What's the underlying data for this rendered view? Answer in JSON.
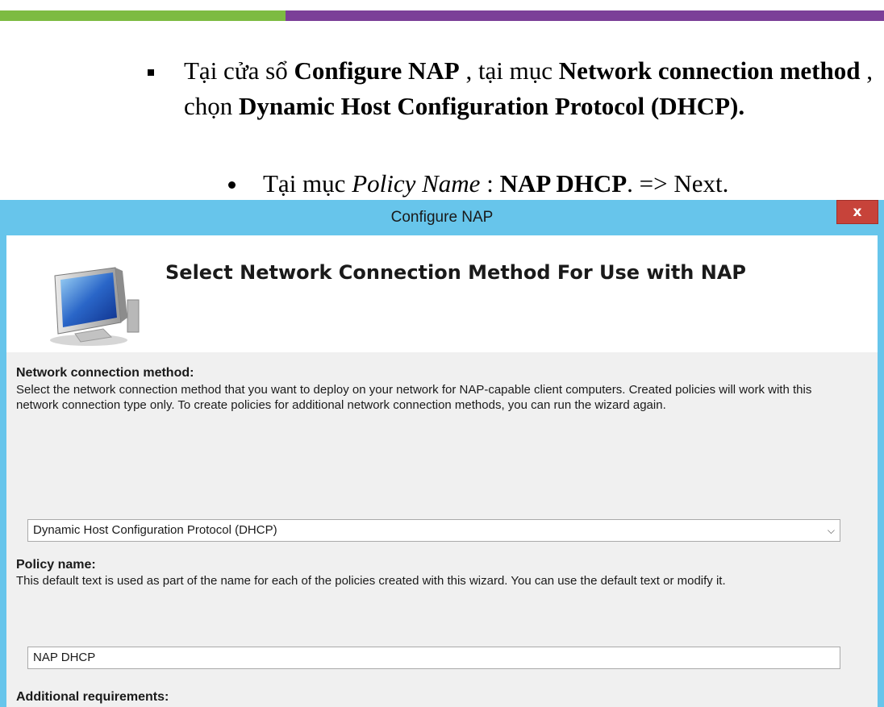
{
  "doc": {
    "line1_prefix": "Tại cửa sổ ",
    "line1_window": "Configure NAP",
    "line1_mid": " , tại mục ",
    "line1_section": "Network connection method",
    "line1_choose": " , chọn ",
    "line1_option": "Dynamic Host Configuration Protocol (DHCP).",
    "line2_prefix": "Tại mục ",
    "line2_field": "Policy Name",
    "line2_sep": " : ",
    "line2_value": "NAP DHCP",
    "line2_suffix": ". => Next."
  },
  "dialog": {
    "title": "Configure NAP",
    "close_label": "x",
    "heading": "Select Network Connection Method For Use with NAP",
    "network_method_label": "Network connection method:",
    "network_method_desc": "Select the network connection method that you want to deploy on your network for NAP-capable client computers. Created policies will work with this network connection type only. To create policies for additional network connection methods, you can run the wizard again.",
    "network_method_value": "Dynamic Host Configuration Protocol (DHCP)",
    "policy_name_label": "Policy name:",
    "policy_name_desc": "This default text is used as part of the name for each of the policies created with this wizard. You can use the default text or modify it.",
    "policy_name_value": "NAP DHCP",
    "additional_label": "Additional requirements:"
  },
  "icons": {
    "dropdown": "chevron-down-icon",
    "wizard": "monitor-icon"
  },
  "colors": {
    "title_bar": "#67c5eb",
    "close_button": "#c7433a",
    "accent_green": "#7dbb42",
    "accent_purple": "#7b3f98"
  }
}
